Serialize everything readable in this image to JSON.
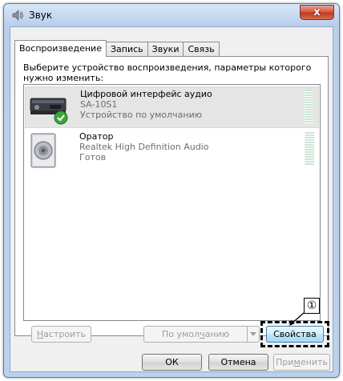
{
  "window": {
    "title": "Звук",
    "close_label": "x",
    "icon": "speaker-icon"
  },
  "tabs": [
    {
      "label": "Воспроизведение",
      "active": true
    },
    {
      "label": "Запись",
      "active": false
    },
    {
      "label": "Звуки",
      "active": false
    },
    {
      "label": "Связь",
      "active": false
    }
  ],
  "prompt": "Выберите устройство воспроизведения, параметры которого нужно изменить:",
  "devices": [
    {
      "name": "Цифровой интерфейс аудио",
      "model": "SA-10S1",
      "status": "Устройство по умолчанию",
      "icon": "digital-audio-device-icon",
      "badge": "default-check-icon",
      "selected": true
    },
    {
      "name": "Оратор",
      "model": "Realtek High Definition Audio",
      "status": "Готов",
      "icon": "speaker-device-icon",
      "selected": false
    }
  ],
  "buttons": {
    "configure": {
      "prefix": "",
      "mnemonic": "Н",
      "suffix": "астроить"
    },
    "set_default": {
      "prefix": "По умол",
      "mnemonic": "ч",
      "suffix": "анию"
    },
    "properties": "Свойства",
    "ok": "ОК",
    "cancel": "Отмена",
    "apply": {
      "prefix": "При",
      "mnemonic": "м",
      "suffix": "енить"
    }
  },
  "callout_number": "①",
  "colors": {
    "title_bar": "#c5d9f1",
    "close_button": "#c1361c",
    "selection": "#e5e5e5",
    "meter": "#cfe5d7",
    "default_check": "#3aa83a"
  }
}
